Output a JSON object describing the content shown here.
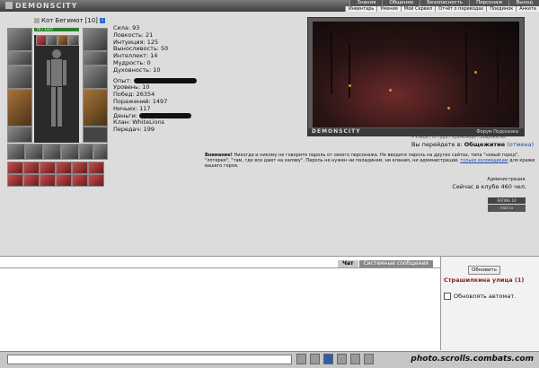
{
  "app": {
    "logo": "DEMONSCITY"
  },
  "topmenu": [
    "Знания",
    "Общение",
    "Безопасность",
    "Персонаж",
    "Выход"
  ],
  "submenu": [
    "Инвентарь",
    "Умения",
    "Мой Сервил",
    "Отчёт о переводах",
    "Поединок",
    "Анкета"
  ],
  "character": {
    "name": "Кот Бегимот",
    "level": "[10]",
    "hp": "79 / 1337"
  },
  "stats": {
    "strength": "Сила: 93",
    "agility": "Ловкость: 21",
    "intuition": "Интуиция: 125",
    "stamina": "Выносливость: 50",
    "intellect": "Интеллект: 14",
    "wisdom": "Мудрость: 0",
    "spirit": "Духовность: 10",
    "exp": "Опыт:",
    "level": "Уровень: 10",
    "wins": "Побед: 26354",
    "losses": "Поражений: 1497",
    "draws": "Ничьих: 117",
    "money": "Деньги:",
    "clan": "Клан: WhiteLions",
    "transfers": "Передач: 199"
  },
  "scene": {
    "logo": "DEMONSCITY",
    "links": "Форум   Подсказка"
  },
  "location": {
    "path": "« Улица  |  Оттуда / Хранилище / Общежитие",
    "going_prefix": "Вы перейдете в: ",
    "going_to": "Общежитие",
    "cancel": "(отмена)"
  },
  "warning": {
    "bold": "Внимание!",
    "text": " Никогда и никому не говорите пароль от своего персонажа. Не вводите пароль на других сайтах, типа \"новый город\", \"лотерея\", \"там, где все дают на халяву\". Пароль не нужен ни паладинам, ни кланам, ни администрации, ",
    "link": "только взломщикам",
    "tail": " для кражи вашего героя.",
    "admin": "Администрация.",
    "online": "Сейчас в клубе 460 чел."
  },
  "counters": {
    "top": "RATING 10",
    "bottom": "mail.ru"
  },
  "chat": {
    "tabs": [
      "Чат",
      "Системные сообщения"
    ],
    "active_tab": "Чат"
  },
  "side": {
    "refresh": "Обновить",
    "street": "Страшилкина улица (1)",
    "auto_refresh": "Обновлять автомат."
  },
  "footer": {
    "watermark": "photo.scrolls.combats.com"
  },
  "colors": {
    "accent_red": "#8a1a1a",
    "link_blue": "#1a4aa8",
    "panel_gray": "#dcdcdc"
  }
}
